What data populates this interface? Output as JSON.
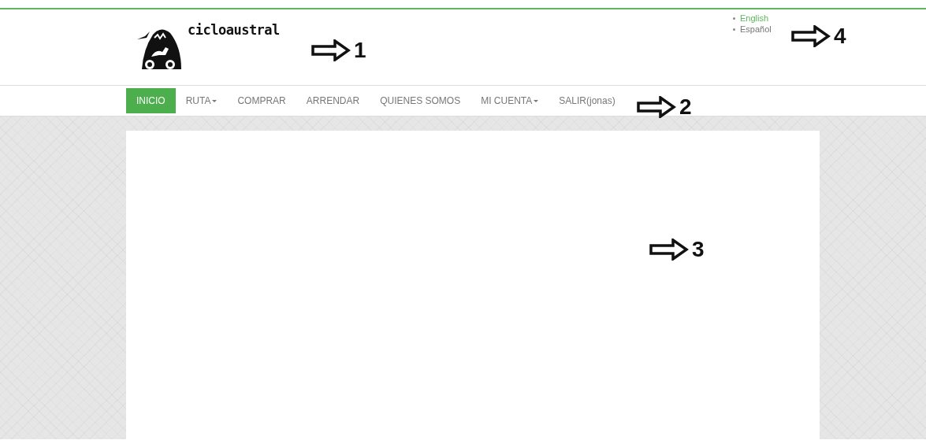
{
  "logo": {
    "text": "cicloaustral"
  },
  "languages": [
    {
      "label": "English",
      "selected": true
    },
    {
      "label": "Español",
      "selected": false
    }
  ],
  "nav": [
    {
      "label": "INICIO",
      "selected": true,
      "dropdown": false
    },
    {
      "label": "RUTA",
      "selected": false,
      "dropdown": true
    },
    {
      "label": "COMPRAR",
      "selected": false,
      "dropdown": false
    },
    {
      "label": "ARRENDAR",
      "selected": false,
      "dropdown": false
    },
    {
      "label": "QUIENES SOMOS",
      "selected": false,
      "dropdown": false
    },
    {
      "label": "MI CUENTA",
      "selected": false,
      "dropdown": true
    },
    {
      "label": "SALIR(jonas)",
      "selected": false,
      "dropdown": false
    }
  ],
  "annotations": [
    {
      "label": "1"
    },
    {
      "label": "2"
    },
    {
      "label": "3"
    },
    {
      "label": "4"
    }
  ]
}
